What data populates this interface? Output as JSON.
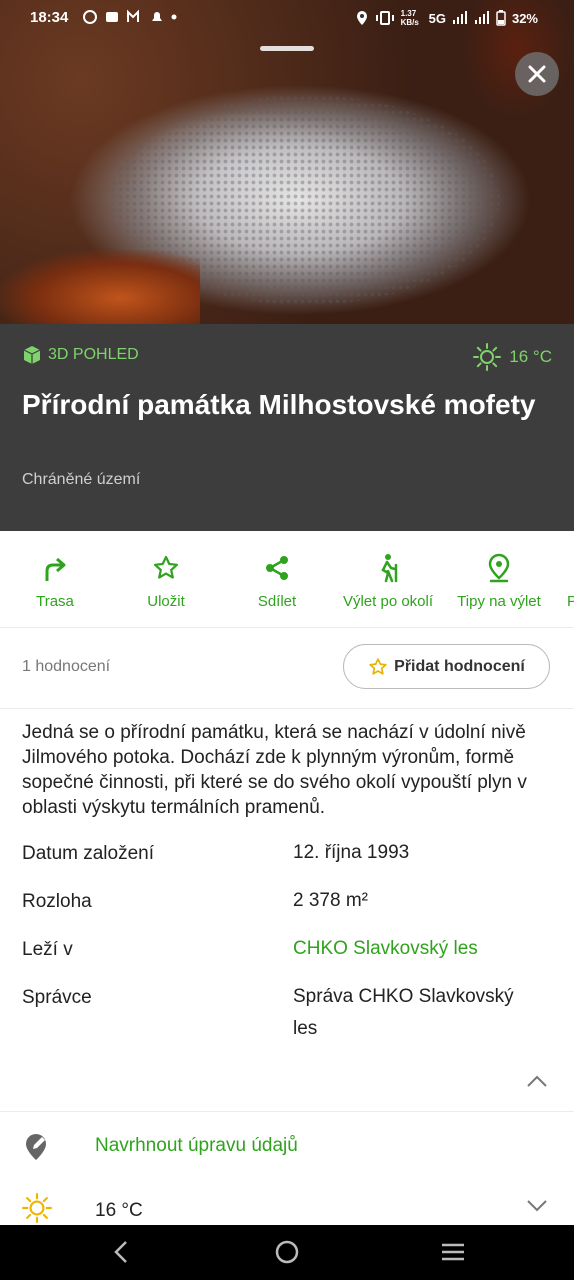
{
  "status": {
    "time": "18:34",
    "net_speed": "1.37 KB/s",
    "network": "5G",
    "battery": "32%"
  },
  "hero": {
    "badge_3d": "3D POHLED",
    "weather_temp": "16 °C",
    "title": "Přírodní památka Milhostovské mofety",
    "subtitle": "Chráněné území"
  },
  "actions": [
    {
      "label": "Trasa",
      "icon": "route-icon"
    },
    {
      "label": "Uložit",
      "icon": "star-icon"
    },
    {
      "label": "Sdílet",
      "icon": "share-icon"
    },
    {
      "label": "Výlet po okolí",
      "icon": "hiker-icon"
    },
    {
      "label": "Tipy na výlet",
      "icon": "pin-icon"
    },
    {
      "label": "P",
      "icon": "more"
    }
  ],
  "rating": {
    "count": "1 hodnocení",
    "add_button": "Přidat hodnocení"
  },
  "description": "Jedná se o přírodní památku, která se nachází v údolní nivě Jilmového potoka. Dochází zde k plynným výronům, formě sopečné činnosti, při které se do svého okolí vypouští plyn v oblasti výskytu termálních pramenů.",
  "properties": [
    {
      "key": "Datum založení",
      "value": "12. října 1993"
    },
    {
      "key": "Rozloha",
      "value": "2 378 m²"
    },
    {
      "key": "Leží v",
      "value": "CHKO Slavkovský les"
    },
    {
      "key": "Správce",
      "value": "Správa CHKO Slavkovský les"
    }
  ],
  "suggest_edit": "Navrhnout úpravu údajů",
  "weather_row": "16 °C",
  "colors": {
    "accent": "#2fa31d",
    "infobar": "#3d3d3d",
    "accent_light": "#7fd36b"
  }
}
